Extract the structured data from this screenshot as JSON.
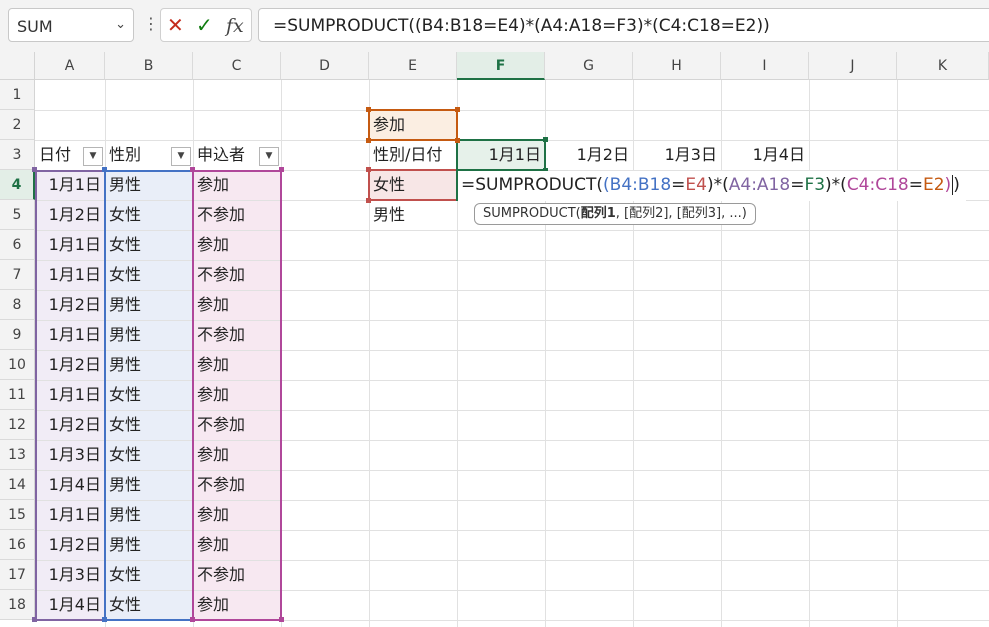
{
  "toolbar": {
    "name_box": "SUM",
    "name_box_arrow": "⌄",
    "more": "⋮",
    "cancel": "✕",
    "enter": "✓",
    "fx": "fx",
    "formula": "=SUMPRODUCT((B4:B18=E4)*(A4:A18=F3)*(C4:C18=E2))"
  },
  "columns": [
    "A",
    "B",
    "C",
    "D",
    "E",
    "F",
    "G",
    "H",
    "I",
    "J",
    "K"
  ],
  "rows": [
    "1",
    "2",
    "3",
    "4",
    "5",
    "6",
    "7",
    "8",
    "9",
    "10",
    "11",
    "12",
    "13",
    "14",
    "15",
    "16",
    "17",
    "18"
  ],
  "headers": {
    "date": "日付",
    "gender": "性別",
    "applicant": "申込者"
  },
  "table": [
    {
      "date": "1月1日",
      "gender": "男性",
      "applicant": "参加"
    },
    {
      "date": "1月2日",
      "gender": "女性",
      "applicant": "不参加"
    },
    {
      "date": "1月1日",
      "gender": "女性",
      "applicant": "参加"
    },
    {
      "date": "1月1日",
      "gender": "女性",
      "applicant": "不参加"
    },
    {
      "date": "1月2日",
      "gender": "男性",
      "applicant": "参加"
    },
    {
      "date": "1月1日",
      "gender": "男性",
      "applicant": "不参加"
    },
    {
      "date": "1月2日",
      "gender": "男性",
      "applicant": "参加"
    },
    {
      "date": "1月1日",
      "gender": "女性",
      "applicant": "参加"
    },
    {
      "date": "1月2日",
      "gender": "女性",
      "applicant": "不参加"
    },
    {
      "date": "1月3日",
      "gender": "女性",
      "applicant": "参加"
    },
    {
      "date": "1月4日",
      "gender": "男性",
      "applicant": "不参加"
    },
    {
      "date": "1月1日",
      "gender": "男性",
      "applicant": "参加"
    },
    {
      "date": "1月2日",
      "gender": "男性",
      "applicant": "参加"
    },
    {
      "date": "1月3日",
      "gender": "女性",
      "applicant": "不参加"
    },
    {
      "date": "1月4日",
      "gender": "女性",
      "applicant": "参加"
    }
  ],
  "summary": {
    "e2": "参加",
    "e3": "性別/日付",
    "f3": "1月1日",
    "g3": "1月2日",
    "h3": "1月3日",
    "i3": "1月4日",
    "e4": "女性",
    "e5": "男性"
  },
  "edit": {
    "p1": "=SUMPRODUCT(",
    "p2": "(",
    "r1": "B4:B18",
    "eq1": "=",
    "r2": "E4",
    "p3": ")*(",
    "r3": "A4:A18",
    "eq2": "=",
    "r4": "F3",
    "p4": ")*(",
    "r5": "C4:C18",
    "eq3": "=",
    "r6": "E2",
    "p5": ")",
    "p6": ")"
  },
  "tooltip": {
    "fn": "SUMPRODUCT(",
    "arg1": "配列1",
    "rest": ", [配列2], [配列3], ...)"
  },
  "colors": {
    "green": "#1e7145",
    "blue": "#4472c4",
    "red": "#c0504d",
    "purple": "#8064a2",
    "magenta": "#b0479a",
    "orange": "#c55a11"
  }
}
